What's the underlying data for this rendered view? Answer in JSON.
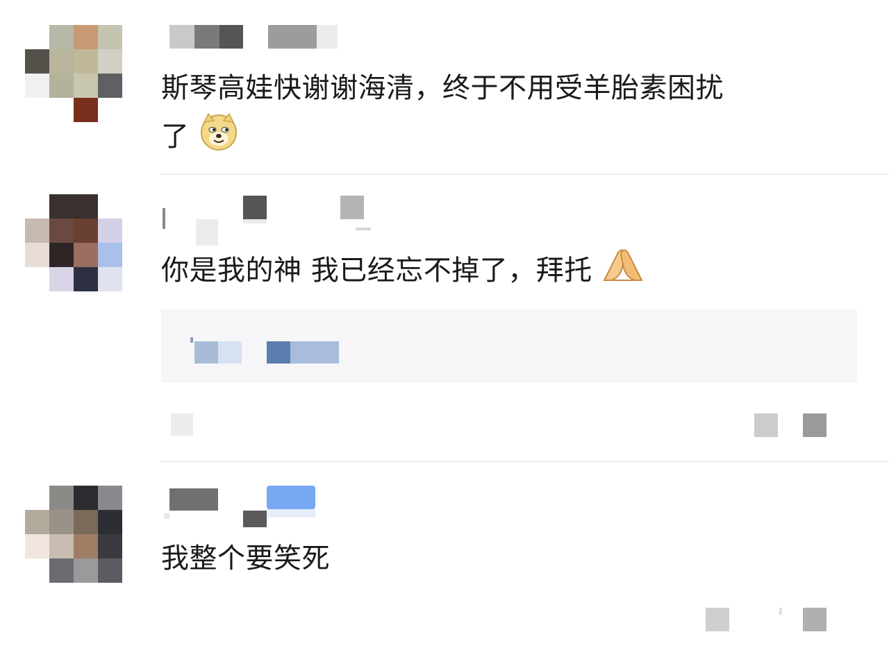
{
  "comments": [
    {
      "id": "comment-1",
      "text_line1": "斯琴高娃快谢谢海清，终于不用受羊胎素困扰",
      "text_line2": "了",
      "emoji": "doge-emoji"
    },
    {
      "id": "comment-2",
      "text": "你是我的神  我已经忘不掉了，拜托",
      "emoji": "pleading-hands-emoji"
    },
    {
      "id": "comment-3",
      "text": "我整个要笑死"
    }
  ],
  "colors": {
    "background": "#ffffff",
    "text": "#1a1a1a",
    "divider": "#ececec",
    "reply_box": "#f6f6f8",
    "link_blue": "#5a7fae"
  },
  "icons": {
    "doge": "doge-emoji",
    "hands": "pleading-hands-emoji"
  }
}
